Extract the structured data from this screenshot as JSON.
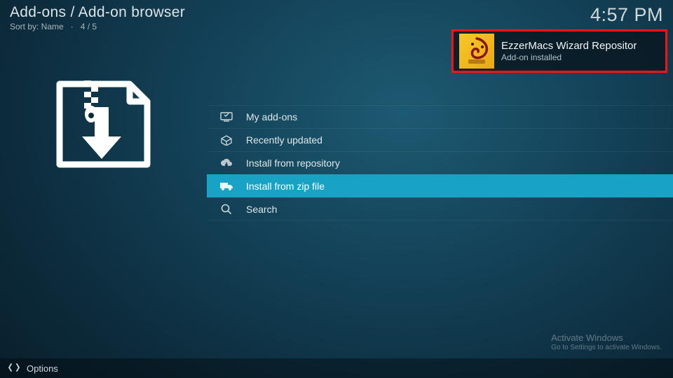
{
  "header": {
    "breadcrumb": "Add-ons / Add-on browser",
    "sort_label": "Sort by: Name",
    "position": "4 / 5",
    "clock": "4:57 PM"
  },
  "menu": {
    "items": [
      {
        "icon": "monitor-icon",
        "label": "My add-ons",
        "selected": false
      },
      {
        "icon": "open-box-icon",
        "label": "Recently updated",
        "selected": false
      },
      {
        "icon": "cloud-download-icon",
        "label": "Install from repository",
        "selected": false
      },
      {
        "icon": "truck-icon",
        "label": "Install from zip file",
        "selected": true
      },
      {
        "icon": "search-icon",
        "label": "Search",
        "selected": false
      }
    ]
  },
  "notification": {
    "title": "EzzerMacs Wizard Repositor",
    "subtitle": "Add-on installed",
    "icon_name": "ezzermacs-icon"
  },
  "watermark": {
    "title": "Activate Windows",
    "subtitle": "Go to Settings to activate Windows."
  },
  "footer": {
    "options_label": "Options"
  }
}
